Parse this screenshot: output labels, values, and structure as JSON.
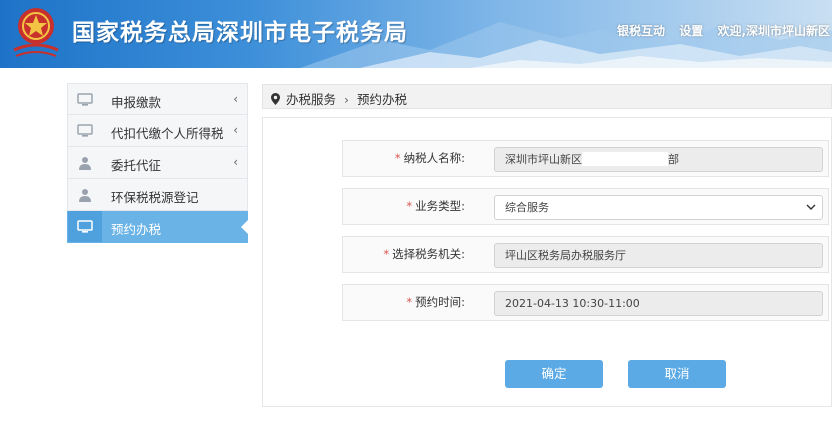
{
  "header": {
    "title": "国家税务总局深圳市电子税务局",
    "links": [
      "银税互动",
      "设置",
      "欢迎,深圳市坪山新区"
    ]
  },
  "sidebar": {
    "items": [
      {
        "label": "申报缴款",
        "icon": "monitor-icon",
        "chevron": "‹",
        "active": false
      },
      {
        "label": "代扣代缴个人所得税",
        "icon": "monitor-icon",
        "chevron": "‹",
        "active": false
      },
      {
        "label": "委托代征",
        "icon": "user-icon",
        "chevron": "‹",
        "active": false
      },
      {
        "label": "环保税税源登记",
        "icon": "user-icon",
        "chevron": "",
        "active": false
      },
      {
        "label": "预约办税",
        "icon": "monitor-icon",
        "chevron": "",
        "active": true
      }
    ]
  },
  "breadcrumb": {
    "root": "办税服务",
    "separator": "›",
    "current": "预约办税"
  },
  "form": {
    "required_mark": "*",
    "taxpayer": {
      "label": "纳税人名称:",
      "value_prefix": "深圳市坪山新区",
      "value_suffix": "部"
    },
    "business_type": {
      "label": "业务类型:",
      "value": "综合服务"
    },
    "tax_office": {
      "label": "选择税务机关:",
      "value": "坪山区税务局办税服务厅"
    },
    "appointment_time": {
      "label": "预约时间:",
      "value": "2021-04-13 10:30-11:00"
    }
  },
  "buttons": {
    "confirm": "确定",
    "cancel": "取消"
  },
  "colors": {
    "accent": "#5ba9e5",
    "active_nav": "#6ab3e6",
    "required": "#d9534f"
  }
}
